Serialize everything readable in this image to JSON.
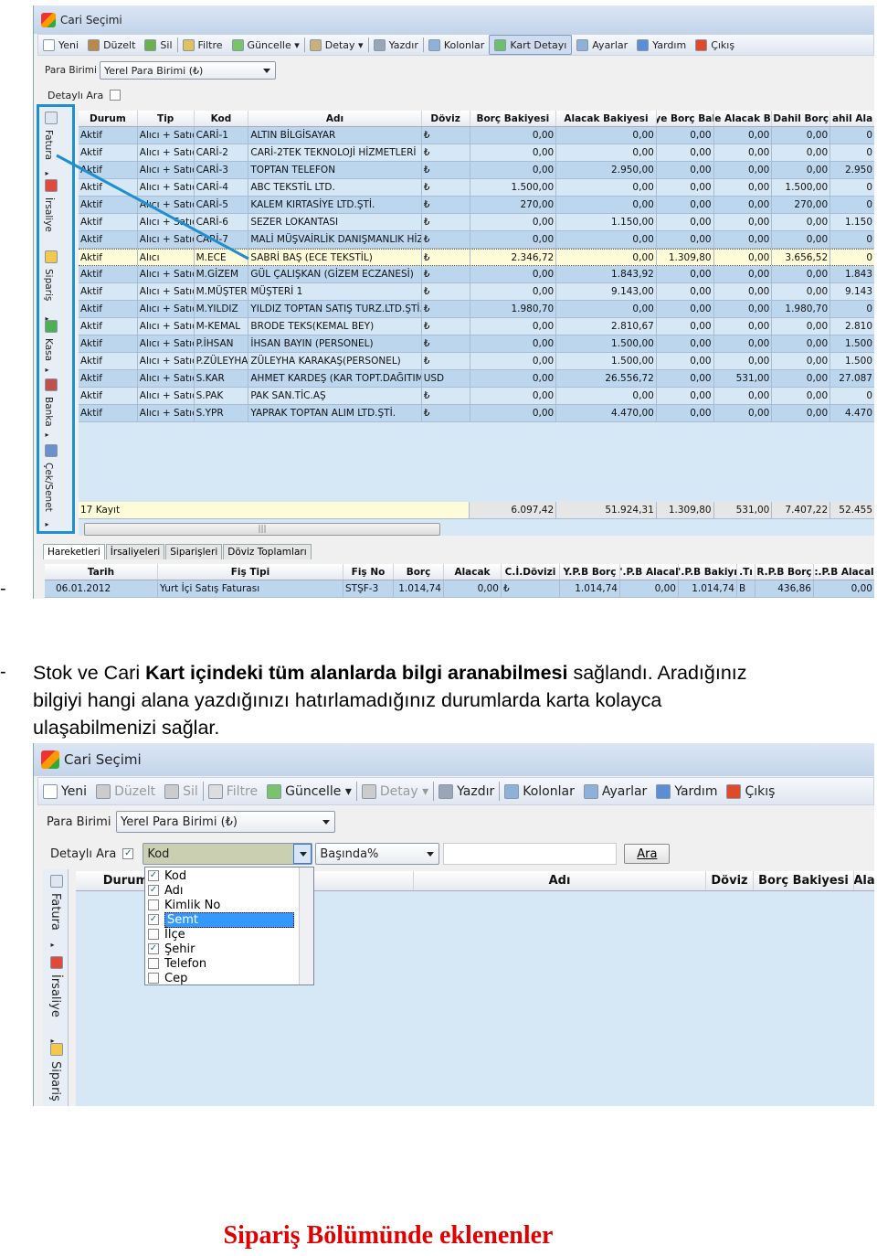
{
  "window_title": "Cari Seçimi",
  "toolbar": [
    {
      "label": "Yeni",
      "icon": "new-doc-icon",
      "color": "#ffffff"
    },
    {
      "label": "Düzelt",
      "icon": "edit-icon",
      "color": "#b88a4a"
    },
    {
      "label": "Sil",
      "icon": "delete-icon",
      "color": "#6ab04c"
    },
    {
      "sep": true
    },
    {
      "label": "Filtre",
      "icon": "search-icon",
      "color": "#e0c060"
    },
    {
      "label": "Güncelle ▾",
      "icon": "refresh-icon",
      "color": "#7bc36b"
    },
    {
      "sep": true
    },
    {
      "label": "Detay ▾",
      "icon": "detail-icon",
      "color": "#c9b27a"
    },
    {
      "sep": true
    },
    {
      "label": "Yazdır",
      "icon": "printer-icon",
      "color": "#9aa6b5"
    },
    {
      "sep": true
    },
    {
      "label": "Kolonlar",
      "icon": "columns-icon",
      "color": "#8fb1d9"
    },
    {
      "label": "Kart Detayı",
      "icon": "card-detail-icon",
      "color": "#6cbf6c",
      "active": true
    },
    {
      "label": "Ayarlar",
      "icon": "settings-icon",
      "color": "#8fb1d9"
    },
    {
      "label": "Yardım",
      "icon": "help-icon",
      "color": "#5a8fd6"
    },
    {
      "label": "Çıkış",
      "icon": "exit-icon",
      "color": "#e04a2a"
    }
  ],
  "para_birimi_label": "Para Birimi",
  "para_birimi_value": "Yerel Para Birimi (₺)",
  "detayli_ara_label": "Detaylı Ara",
  "sidebar": [
    "Fatura",
    "İrsaliye",
    "Sipariş",
    "Kasa",
    "Banka",
    "Çek/Senet"
  ],
  "grid": {
    "headers": [
      "Durum",
      "Tip",
      "Kod",
      "Adı",
      "Döviz",
      "Borç Bakiyesi",
      "Alacak Bakiyesi",
      "ye Borç Bal",
      "e Alacak B",
      "Dahil Borç",
      "ahil Ala"
    ],
    "rows": [
      [
        "Aktif",
        "Alıcı + Satıcı",
        "CARİ-1",
        "ALTIN BİLGİSAYAR",
        "₺",
        "0,00",
        "0,00",
        "0,00",
        "0,00",
        "0,00",
        "0"
      ],
      [
        "Aktif",
        "Alıcı + Satıcı",
        "CARİ-2",
        "CARİ-2TEK TEKNOLOJİ HİZMETLERİ",
        "₺",
        "0,00",
        "0,00",
        "0,00",
        "0,00",
        "0,00",
        "0"
      ],
      [
        "Aktif",
        "Alıcı + Satıcı",
        "CARİ-3",
        "TOPTAN TELEFON",
        "₺",
        "0,00",
        "2.950,00",
        "0,00",
        "0,00",
        "0,00",
        "2.950"
      ],
      [
        "Aktif",
        "Alıcı + Satıcı",
        "CARİ-4",
        "ABC TEKSTİL LTD.",
        "₺",
        "1.500,00",
        "0,00",
        "0,00",
        "0,00",
        "1.500,00",
        "0"
      ],
      [
        "Aktif",
        "Alıcı + Satıcı",
        "CARİ-5",
        "KALEM KIRTASİYE LTD.ŞTİ.",
        "₺",
        "270,00",
        "0,00",
        "0,00",
        "0,00",
        "270,00",
        "0"
      ],
      [
        "Aktif",
        "Alıcı + Satıcı",
        "CARİ-6",
        "SEZER LOKANTASI",
        "₺",
        "0,00",
        "1.150,00",
        "0,00",
        "0,00",
        "0,00",
        "1.150"
      ],
      [
        "Aktif",
        "Alıcı + Satıcı",
        "CARİ-7",
        "MALİ MÜŞVAİRLİK DANIŞMANLIK HİZM",
        "₺",
        "0,00",
        "0,00",
        "0,00",
        "0,00",
        "0,00",
        "0"
      ],
      [
        "Aktif",
        "Alıcı",
        "M.ECE",
        "SABRİ BAŞ (ECE TEKSTİL)",
        "₺",
        "2.346,72",
        "0,00",
        "1.309,80",
        "0,00",
        "3.656,52",
        "0"
      ],
      [
        "Aktif",
        "Alıcı + Satıcı",
        "M.GİZEM",
        "GÜL ÇALIŞKAN (GİZEM ECZANESİ)",
        "₺",
        "0,00",
        "1.843,92",
        "0,00",
        "0,00",
        "0,00",
        "1.843"
      ],
      [
        "Aktif",
        "Alıcı + Satıcı",
        "M.MÜŞTERİ",
        "MÜŞTERİ 1",
        "₺",
        "0,00",
        "9.143,00",
        "0,00",
        "0,00",
        "0,00",
        "9.143"
      ],
      [
        "Aktif",
        "Alıcı + Satıcı",
        "M.YILDIZ",
        "YILDIZ TOPTAN SATIŞ TURZ.LTD.ŞTİ.",
        "₺",
        "1.980,70",
        "0,00",
        "0,00",
        "0,00",
        "1.980,70",
        "0"
      ],
      [
        "Aktif",
        "Alıcı + Satıcı",
        "M-KEMAL",
        "BRODE TEKS(KEMAL BEY)",
        "₺",
        "0,00",
        "2.810,67",
        "0,00",
        "0,00",
        "0,00",
        "2.810"
      ],
      [
        "Aktif",
        "Alıcı + Satıcı",
        "P.İHSAN",
        "İHSAN BAYIN (PERSONEL)",
        "₺",
        "0,00",
        "1.500,00",
        "0,00",
        "0,00",
        "0,00",
        "1.500"
      ],
      [
        "Aktif",
        "Alıcı + Satıcı",
        "P.ZÜLEYHA",
        "ZÜLEYHA KARAKAŞ(PERSONEL)",
        "₺",
        "0,00",
        "1.500,00",
        "0,00",
        "0,00",
        "0,00",
        "1.500"
      ],
      [
        "Aktif",
        "Alıcı + Satıcı",
        "S.KAR",
        "AHMET KARDEŞ (KAR TOPT.DAĞITIM)",
        "USD",
        "0,00",
        "26.556,72",
        "0,00",
        "531,00",
        "0,00",
        "27.087"
      ],
      [
        "Aktif",
        "Alıcı + Satıcı",
        "S.PAK",
        "PAK SAN.TİC.AŞ",
        "₺",
        "0,00",
        "0,00",
        "0,00",
        "0,00",
        "0,00",
        "0"
      ],
      [
        "Aktif",
        "Alıcı + Satıcı",
        "S.YPR",
        "YAPRAK TOPTAN ALIM LTD.ŞTİ.",
        "₺",
        "0,00",
        "4.470,00",
        "0,00",
        "0,00",
        "0,00",
        "4.470"
      ]
    ],
    "selected_row": 7,
    "footer": {
      "count": "17 Kayıt",
      "totals": [
        "6.097,42",
        "51.924,31",
        "1.309,80",
        "531,00",
        "7.407,22",
        "52.455"
      ]
    }
  },
  "bottom_tabs": [
    "Hareketleri",
    "İrsaliyeleri",
    "Siparişleri",
    "Döviz Toplamları"
  ],
  "bottom_grid": {
    "headers": [
      "Tarih",
      "Fiş Tipi",
      "Fiş No",
      "Borç",
      "Alacak",
      "C.İ.Dövizi",
      "Y.P.B Borç",
      "'.P.B Alacal",
      "'.P.B Bakiyı",
      ".Tı",
      "R.P.B Borç",
      ":.P.B Alacal"
    ],
    "row": [
      "06.01.2012",
      "Yurt İçi Satış Faturası",
      "STŞF-3",
      "1.014,74",
      "0,00",
      "₺",
      "1.014,74",
      "0,00",
      "1.014,74",
      "B",
      "436,86",
      "0,00"
    ]
  },
  "text": {
    "dash1": "-",
    "dash2": "-",
    "line1_a": "Stok ve Cari ",
    "line1_b": "Kart içindeki tüm alanlarda bilgi aranabilmesi",
    "line1_c": " sağlandı. Aradığınız",
    "line2": "bilgiyi hangi alana yazdığınızı hatırlamadığınız durumlarda karta kolayca",
    "line3": "ulaşabilmenizi sağlar."
  },
  "window2": {
    "title": "Cari Seçimi",
    "toolbar": [
      {
        "label": "Yeni",
        "icon": "new-doc-icon",
        "color": "#ffffff"
      },
      {
        "label": "Düzelt",
        "icon": "edit-icon",
        "color": "#ccc",
        "disabled": true
      },
      {
        "label": "Sil",
        "icon": "delete-icon",
        "color": "#ccc",
        "disabled": true
      },
      {
        "sep": true
      },
      {
        "label": "Filtre",
        "icon": "search-icon",
        "color": "#ddd",
        "disabled": true
      },
      {
        "label": "Güncelle ▾",
        "icon": "refresh-icon",
        "color": "#7bc36b"
      },
      {
        "sep": true
      },
      {
        "label": "Detay ▾",
        "icon": "detail-icon",
        "color": "#ccc",
        "disabled": true
      },
      {
        "sep": true
      },
      {
        "label": "Yazdır",
        "icon": "printer-icon",
        "color": "#9aa6b5"
      },
      {
        "sep": true
      },
      {
        "label": "Kolonlar",
        "icon": "columns-icon",
        "color": "#8fb1d9"
      },
      {
        "label": "Ayarlar",
        "icon": "settings-icon",
        "color": "#8fb1d9"
      },
      {
        "label": "Yardım",
        "icon": "help-icon",
        "color": "#5a8fd6"
      },
      {
        "label": "Çıkış",
        "icon": "exit-icon",
        "color": "#e04a2a"
      }
    ],
    "para_birimi_label": "Para Birimi",
    "para_birimi_value": "Yerel Para Birimi (₺)",
    "detayli_ara_label": "Detaylı Ara",
    "field_combo": "Kod",
    "match_combo": "Başında%",
    "search_value": "",
    "search_button": "Ara",
    "headers": [
      "Durum",
      "Adı",
      "Döviz",
      "Borç Bakiyesi",
      "Ala"
    ],
    "dropdown": [
      {
        "label": "Kod",
        "checked": true
      },
      {
        "label": "Adı",
        "checked": true
      },
      {
        "label": "Kimlik No",
        "checked": false
      },
      {
        "label": "Semt",
        "checked": true,
        "highlighted": true
      },
      {
        "label": "İlçe",
        "checked": false
      },
      {
        "label": "Şehir",
        "checked": true
      },
      {
        "label": "Telefon",
        "checked": false
      },
      {
        "label": "Cep",
        "checked": false
      }
    ],
    "sidebar": [
      "Fatura",
      "İrsaliye",
      "Sipariş"
    ]
  },
  "caption": "Sipariş Bölümünde eklenenler",
  "colors": {
    "highlight": "#1e90d0",
    "caption": "#e00000",
    "row_odd": "#bcd6ee",
    "row_even": "#d6e7f6",
    "selected_row": "#fdfbd8"
  }
}
